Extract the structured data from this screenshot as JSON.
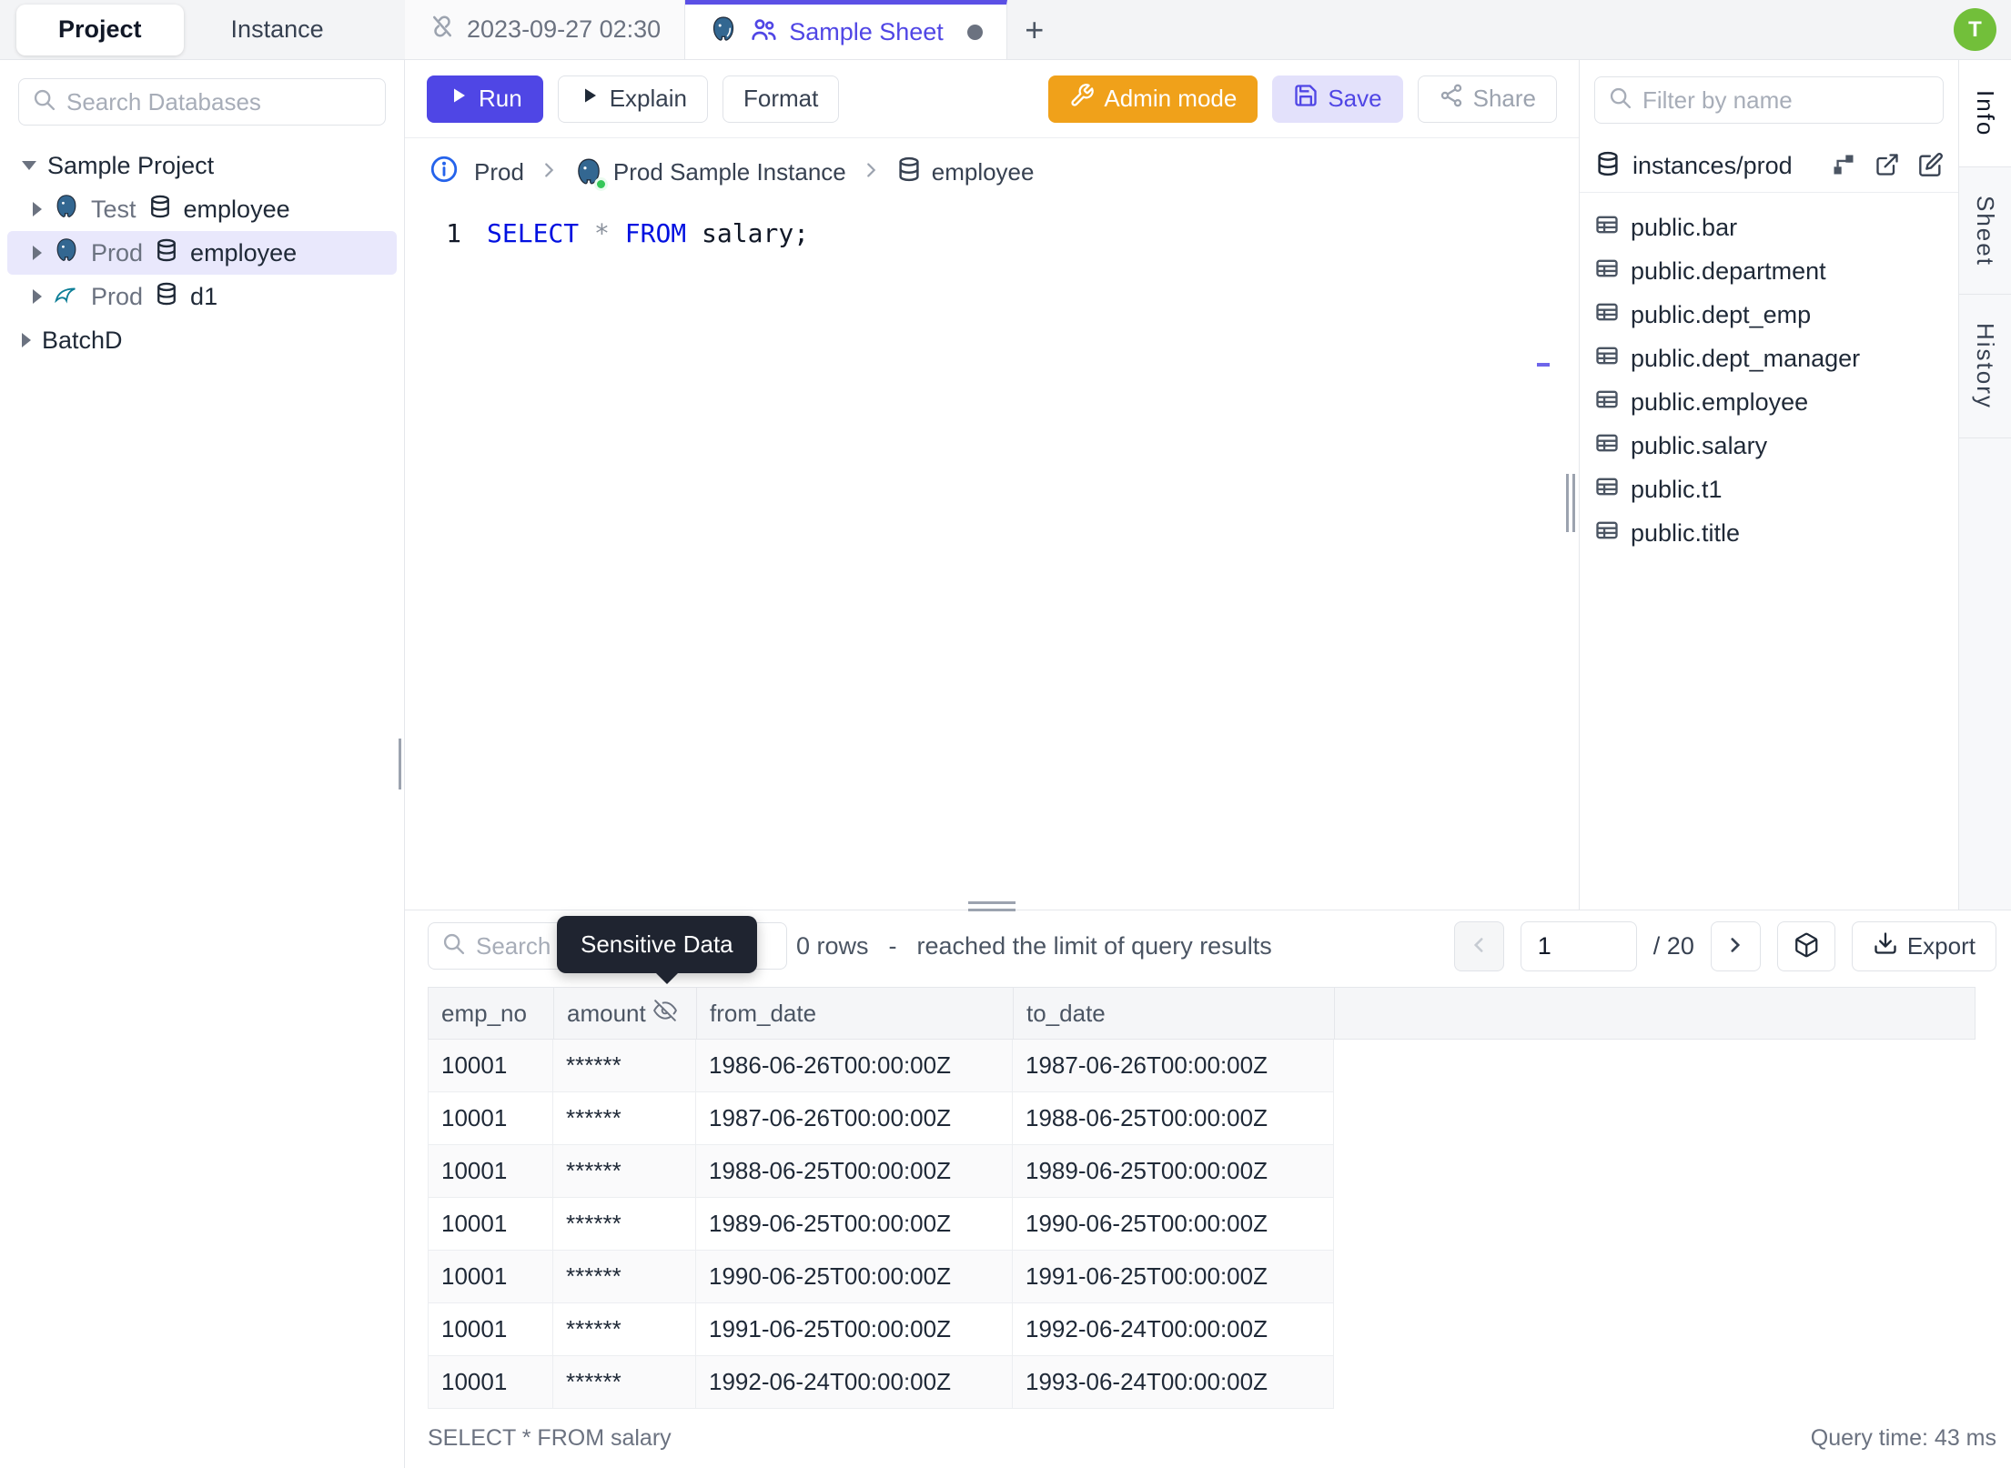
{
  "topbar": {
    "side_tabs": {
      "project": "Project",
      "instance": "Instance"
    },
    "history_tab": "2023-09-27 02:30",
    "sheet_tab": "Sample Sheet",
    "new_tab": "+",
    "avatar_initial": "T"
  },
  "sidebar": {
    "search_placeholder": "Search Databases",
    "tree": [
      {
        "label": "Sample Project"
      },
      {
        "env": "Test",
        "db": "employee"
      },
      {
        "env": "Prod",
        "db": "employee"
      },
      {
        "env": "Prod",
        "db": "d1"
      },
      {
        "label": "BatchD"
      }
    ]
  },
  "toolbar": {
    "run": "Run",
    "explain": "Explain",
    "format": "Format",
    "admin_mode": "Admin mode",
    "save": "Save",
    "share": "Share"
  },
  "breadcrumb": {
    "environment": "Prod",
    "instance": "Prod Sample Instance",
    "database": "employee"
  },
  "editor": {
    "line_number": "1",
    "kw_select": "SELECT",
    "op_star": " * ",
    "kw_from": "FROM",
    "rest": " salary;"
  },
  "schema_panel": {
    "filter_placeholder": "Filter by name",
    "header": "instances/prod",
    "tables": [
      "public.bar",
      "public.department",
      "public.dept_emp",
      "public.dept_manager",
      "public.employee",
      "public.salary",
      "public.t1",
      "public.title"
    ]
  },
  "right_strip": {
    "info": "Info",
    "sheet": "Sheet",
    "history": "History"
  },
  "results": {
    "search_placeholder": "Search",
    "tooltip": "Sensitive Data",
    "row_count": "0 rows",
    "dash": "-",
    "limit_note": "reached the limit of query results",
    "pagination": {
      "page": "1",
      "total": "/ 20"
    },
    "export_label": "Export",
    "table": {
      "headers": {
        "emp_no": "emp_no",
        "amount": "amount",
        "from_date": "from_date",
        "to_date": "to_date"
      },
      "rows": [
        {
          "emp_no": "10001",
          "amount": "******",
          "from_date": "1986-06-26T00:00:00Z",
          "to_date": "1987-06-26T00:00:00Z"
        },
        {
          "emp_no": "10001",
          "amount": "******",
          "from_date": "1987-06-26T00:00:00Z",
          "to_date": "1988-06-25T00:00:00Z"
        },
        {
          "emp_no": "10001",
          "amount": "******",
          "from_date": "1988-06-25T00:00:00Z",
          "to_date": "1989-06-25T00:00:00Z"
        },
        {
          "emp_no": "10001",
          "amount": "******",
          "from_date": "1989-06-25T00:00:00Z",
          "to_date": "1990-06-25T00:00:00Z"
        },
        {
          "emp_no": "10001",
          "amount": "******",
          "from_date": "1990-06-25T00:00:00Z",
          "to_date": "1991-06-25T00:00:00Z"
        },
        {
          "emp_no": "10001",
          "amount": "******",
          "from_date": "1991-06-25T00:00:00Z",
          "to_date": "1992-06-24T00:00:00Z"
        },
        {
          "emp_no": "10001",
          "amount": "******",
          "from_date": "1992-06-24T00:00:00Z",
          "to_date": "1993-06-24T00:00:00Z"
        }
      ]
    },
    "status_query": "SELECT * FROM salary",
    "query_time": "Query time: 43 ms"
  },
  "colors": {
    "accent_indigo": "#4f46e5",
    "admin_orange": "#f0a11a",
    "avatar_green": "#72bf3a",
    "postgres_blue": "#336791",
    "mysql_teal": "#0d7e97",
    "tooltip_dark": "#1f2430",
    "selected_row_bg": "#e9e8fc"
  }
}
